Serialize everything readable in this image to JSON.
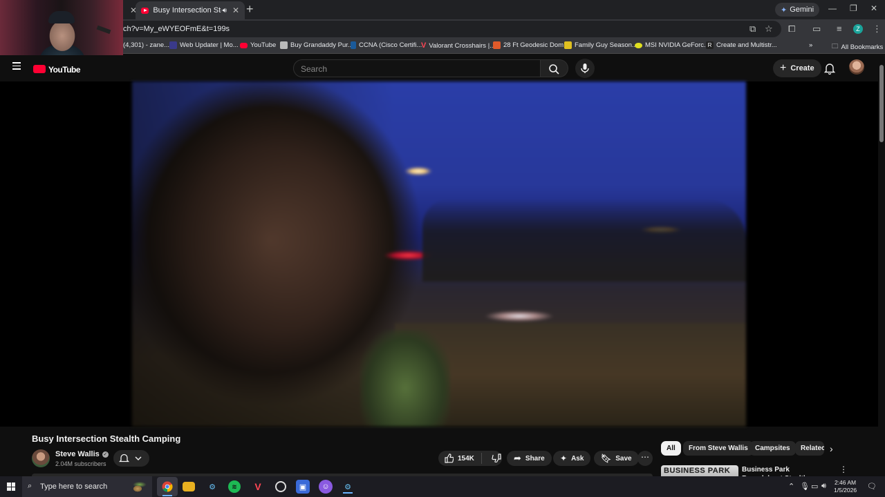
{
  "browser": {
    "tabs": [
      {
        "label": "",
        "active": false
      },
      {
        "label": "Busy Intersection Stealth Ca",
        "active": true
      }
    ],
    "gemini_label": "Gemini",
    "url": "ch?v=My_eWYEOFmE&t=199s",
    "profile_initial": "Z",
    "bookmarks": [
      {
        "label": "(4,301) - zane...",
        "color": "#555"
      },
      {
        "label": "Web Updater | Mo...",
        "color": "#3a3a8a"
      },
      {
        "label": "YouTube",
        "color": "#ff0033"
      },
      {
        "label": "Buy Grandaddy Pur...",
        "color": "#bbb"
      },
      {
        "label": "CCNA (Cisco Certifi...",
        "color": "#1a5a9a"
      },
      {
        "label": "Valorant Crosshairs |...",
        "color": "#ff4655"
      },
      {
        "label": "28 Ft Geodesic Dom...",
        "color": "#e05a2a"
      },
      {
        "label": "Family Guy Season...",
        "color": "#e0c020"
      },
      {
        "label": "MSI NVIDIA GeForc...",
        "color": "#e0e020"
      },
      {
        "label": "Create and Multistr...",
        "color": "#222"
      }
    ],
    "all_bookmarks_label": "All Bookmarks"
  },
  "youtube": {
    "logo_text": "YouTube",
    "search_placeholder": "Search",
    "create_label": "Create",
    "video": {
      "title": "Busy Intersection Stealth Camping",
      "channel": "Steve Wallis",
      "subscribers": "2.04M subscribers",
      "likes": "154K",
      "share_label": "Share",
      "ask_label": "Ask",
      "save_label": "Save"
    },
    "chips": [
      "All",
      "From Steve Wallis",
      "Campsites",
      "Relatec"
    ],
    "recommendation": {
      "thumb_text": "BUSINESS PARK",
      "title": "Business Park Roundabout Stealth Camping"
    }
  },
  "taskbar": {
    "search_placeholder": "Type here to search",
    "time": "2:46 AM",
    "date": "1/5/2026"
  }
}
